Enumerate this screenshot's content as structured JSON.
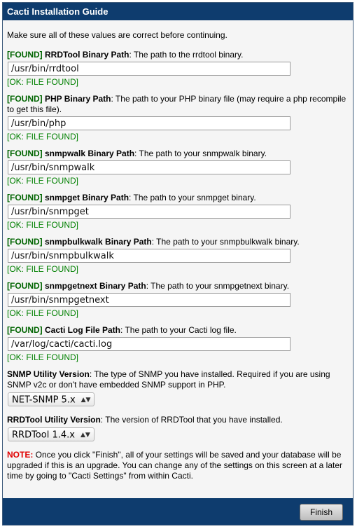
{
  "window": {
    "title": "Cacti Installation Guide"
  },
  "intro": "Make sure all of these values are correct before continuing.",
  "found_tag": "[FOUND]",
  "paths": [
    {
      "name": "RRDTool Binary Path",
      "desc": ": The path to the rrdtool binary.",
      "value": "/usr/bin/rrdtool",
      "status": "[OK: FILE FOUND]"
    },
    {
      "name": "PHP Binary Path",
      "desc": ": The path to your PHP binary file (may require a php recompile to get this file).",
      "value": "/usr/bin/php",
      "status": "[OK: FILE FOUND]"
    },
    {
      "name": "snmpwalk Binary Path",
      "desc": ": The path to your snmpwalk binary.",
      "value": "/usr/bin/snmpwalk",
      "status": "[OK: FILE FOUND]"
    },
    {
      "name": "snmpget Binary Path",
      "desc": ": The path to your snmpget binary.",
      "value": "/usr/bin/snmpget",
      "status": "[OK: FILE FOUND]"
    },
    {
      "name": "snmpbulkwalk Binary Path",
      "desc": ": The path to your snmpbulkwalk binary.",
      "value": "/usr/bin/snmpbulkwalk",
      "status": "[OK: FILE FOUND]"
    },
    {
      "name": "snmpgetnext Binary Path",
      "desc": ": The path to your snmpgetnext binary.",
      "value": "/usr/bin/snmpgetnext",
      "status": "[OK: FILE FOUND]"
    },
    {
      "name": "Cacti Log File Path",
      "desc": ": The path to your Cacti log file.",
      "value": "/var/log/cacti/cacti.log",
      "status": "[OK: FILE FOUND]"
    }
  ],
  "snmp": {
    "name": "SNMP Utility Version",
    "desc": ": The type of SNMP you have installed. Required if you are using SNMP v2c or don't have embedded SNMP support in PHP.",
    "selected": "NET-SNMP 5.x"
  },
  "rrd": {
    "name": "RRDTool Utility Version",
    "desc": ": The version of RRDTool that you have installed.",
    "selected": "RRDTool 1.4.x"
  },
  "note": {
    "label": "NOTE:",
    "text": " Once you click \"Finish\", all of your settings will be saved and your database will be upgraded if this is an upgrade. You can change any of the settings on this screen at a later time by going to \"Cacti Settings\" from within Cacti."
  },
  "finish_label": "Finish",
  "select_arrow": "▲▼"
}
